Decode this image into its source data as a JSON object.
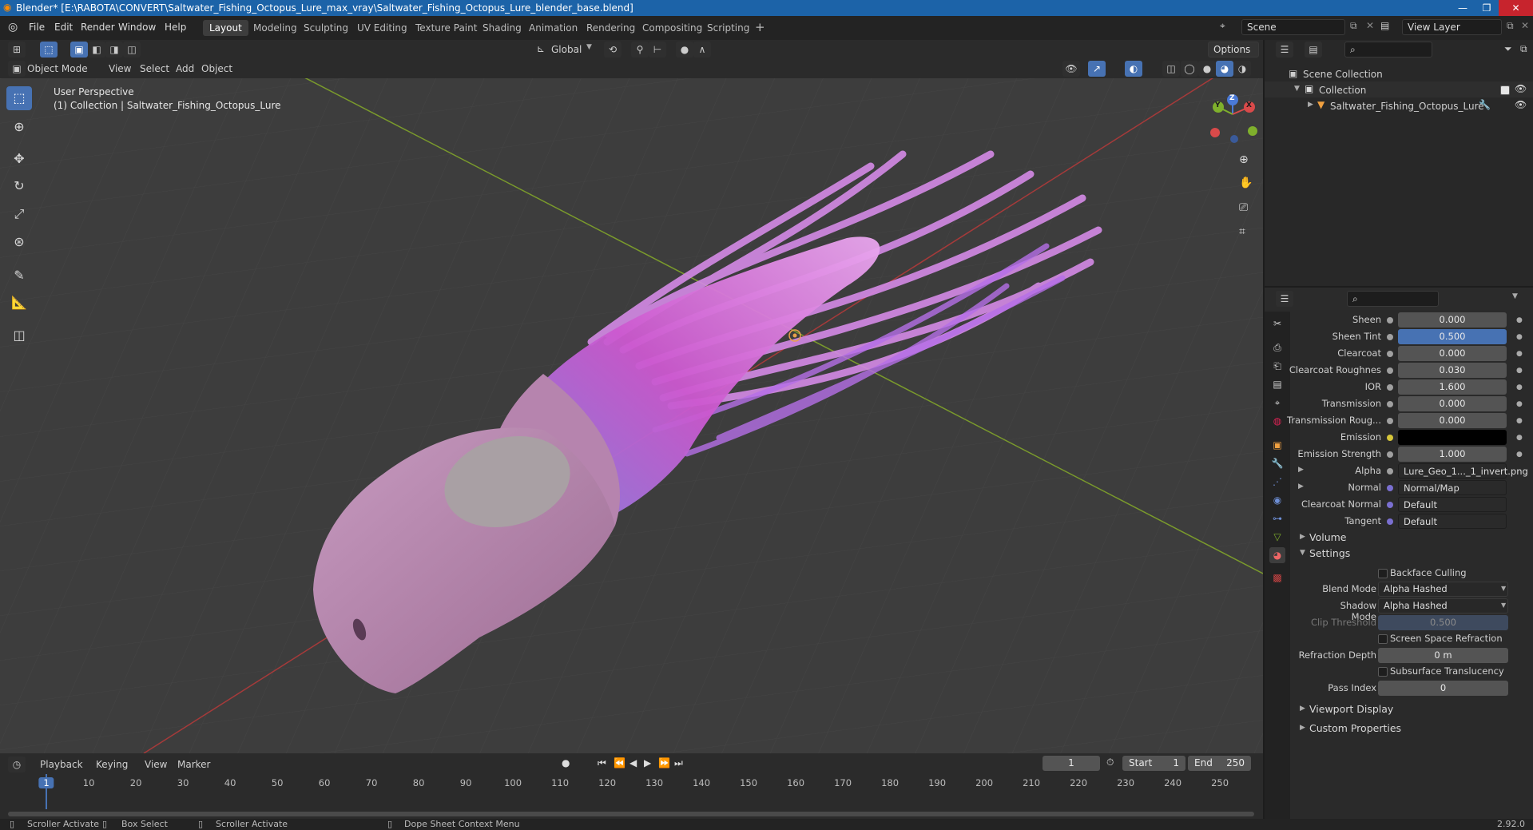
{
  "window": {
    "title": "Blender* [E:\\RABOTA\\CONVERT\\Saltwater_Fishing_Octopus_Lure_max_vray\\Saltwater_Fishing_Octopus_Lure_blender_base.blend]"
  },
  "menu": [
    "File",
    "Edit",
    "Render",
    "Window",
    "Help"
  ],
  "workspaces": [
    "Layout",
    "Modeling",
    "Sculpting",
    "UV Editing",
    "Texture Paint",
    "Shading",
    "Animation",
    "Rendering",
    "Compositing",
    "Scripting"
  ],
  "active_workspace": "Layout",
  "scene": {
    "label": "Scene",
    "view_layer": "View Layer"
  },
  "viewport_header": {
    "transform_orientation": "Global",
    "options": "Options",
    "mode": "Object Mode",
    "menus": [
      "View",
      "Select",
      "Add",
      "Object"
    ]
  },
  "viewport": {
    "perspective": "User Perspective",
    "collection_info": "(1) Collection | Saltwater_Fishing_Octopus_Lure",
    "gizmo": {
      "x": "X",
      "y": "Y",
      "z": "Z"
    }
  },
  "outliner": {
    "scene_collection": "Scene Collection",
    "collection": "Collection",
    "object": "Saltwater_Fishing_Octopus_Lure"
  },
  "properties": {
    "rows": [
      {
        "label": "Sheen",
        "value": "0.000",
        "kind": "num"
      },
      {
        "label": "Sheen Tint",
        "value": "0.500",
        "kind": "sel"
      },
      {
        "label": "Clearcoat",
        "value": "0.000",
        "kind": "num"
      },
      {
        "label": "Clearcoat Roughnes",
        "value": "0.030",
        "kind": "num"
      },
      {
        "label": "IOR",
        "value": "1.600",
        "kind": "num"
      },
      {
        "label": "Transmission",
        "value": "0.000",
        "kind": "num"
      },
      {
        "label": "Transmission Roug...",
        "value": "0.000",
        "kind": "num"
      },
      {
        "label": "Emission",
        "value": "",
        "kind": "black"
      },
      {
        "label": "Emission Strength",
        "value": "1.000",
        "kind": "num"
      },
      {
        "label": "Alpha",
        "value": "Lure_Geo_1..._1_invert.png",
        "kind": "link"
      },
      {
        "label": "Normal",
        "value": "Normal/Map",
        "kind": "link"
      },
      {
        "label": "Clearcoat Normal",
        "value": "Default",
        "kind": "link"
      },
      {
        "label": "Tangent",
        "value": "Default",
        "kind": "link"
      }
    ],
    "volume": "Volume",
    "settings": "Settings",
    "backface_culling": "Backface Culling",
    "blend_mode_label": "Blend Mode",
    "blend_mode": "Alpha Hashed",
    "shadow_mode_label": "Shadow Mode",
    "shadow_mode": "Alpha Hashed",
    "clip_threshold_label": "Clip Threshold",
    "clip_threshold": "0.500",
    "ssr": "Screen Space Refraction",
    "refraction_depth_label": "Refraction Depth",
    "refraction_depth": "0 m",
    "sss": "Subsurface Translucency",
    "pass_index_label": "Pass Index",
    "pass_index": "0",
    "viewport_display": "Viewport Display",
    "custom_properties": "Custom Properties"
  },
  "timeline": {
    "menus": [
      "Playback",
      "Keying",
      "View",
      "Marker"
    ],
    "current_frame": "1",
    "start_label": "Start",
    "start": "1",
    "end_label": "End",
    "end": "250",
    "ticks": [
      "1",
      "10",
      "20",
      "30",
      "40",
      "50",
      "60",
      "70",
      "80",
      "90",
      "100",
      "110",
      "120",
      "130",
      "140",
      "150",
      "160",
      "170",
      "180",
      "190",
      "200",
      "210",
      "220",
      "230",
      "240",
      "250"
    ]
  },
  "status": {
    "items": [
      "Scroller Activate",
      "Box Select",
      "Scroller Activate",
      "Dope Sheet Context Menu"
    ],
    "version": "2.92.0"
  },
  "colors": {
    "accent": "#4772b3",
    "lure_pink": "#c35ccf",
    "lure_head": "#b07fa6"
  }
}
